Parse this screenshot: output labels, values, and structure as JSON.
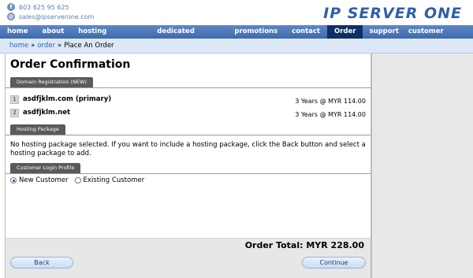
{
  "header": {
    "phone": "603 625 95 625",
    "email": "sales@ipserverone.com",
    "logo_text": "IP SERVER ONE"
  },
  "nav": {
    "items": [
      {
        "label": "home"
      },
      {
        "label": "about"
      },
      {
        "label": "hosting solutions"
      },
      {
        "label": "dedicated server"
      },
      {
        "label": "promotions"
      },
      {
        "label": "contact"
      },
      {
        "label": "Order"
      }
    ],
    "right_items": [
      {
        "label": "support"
      },
      {
        "label": "customer login"
      }
    ]
  },
  "breadcrumb": {
    "home": "home",
    "order": "order",
    "sep": "»",
    "current": "Place An Order"
  },
  "page": {
    "title": "Order Confirmation",
    "domain_tab": "Domain Registration (NEW)",
    "domains": [
      {
        "num": "1",
        "name": "asdfjklm.com (primary)",
        "price": "3 Years @ MYR 114.00"
      },
      {
        "num": "2",
        "name": "asdfjklm.net",
        "price": "3 Years @ MYR 114.00"
      }
    ],
    "hosting_tab": "Hosting Package",
    "hosting_msg": "No hosting package selected. If you want to include a hosting package, click the Back button and select a hosting package to add.",
    "login_tab": "Customer Login Profile",
    "radio_new": "New Customer",
    "radio_existing": "Existing Customer",
    "total": "Order Total: MYR 228.00",
    "back": "Back",
    "continue": "Continue"
  },
  "colors": {
    "nav": "#4a76b8",
    "nav_active": "#0e2f63",
    "breadcrumb_bg": "#dde8f6",
    "tab": "#5a5a5a"
  }
}
